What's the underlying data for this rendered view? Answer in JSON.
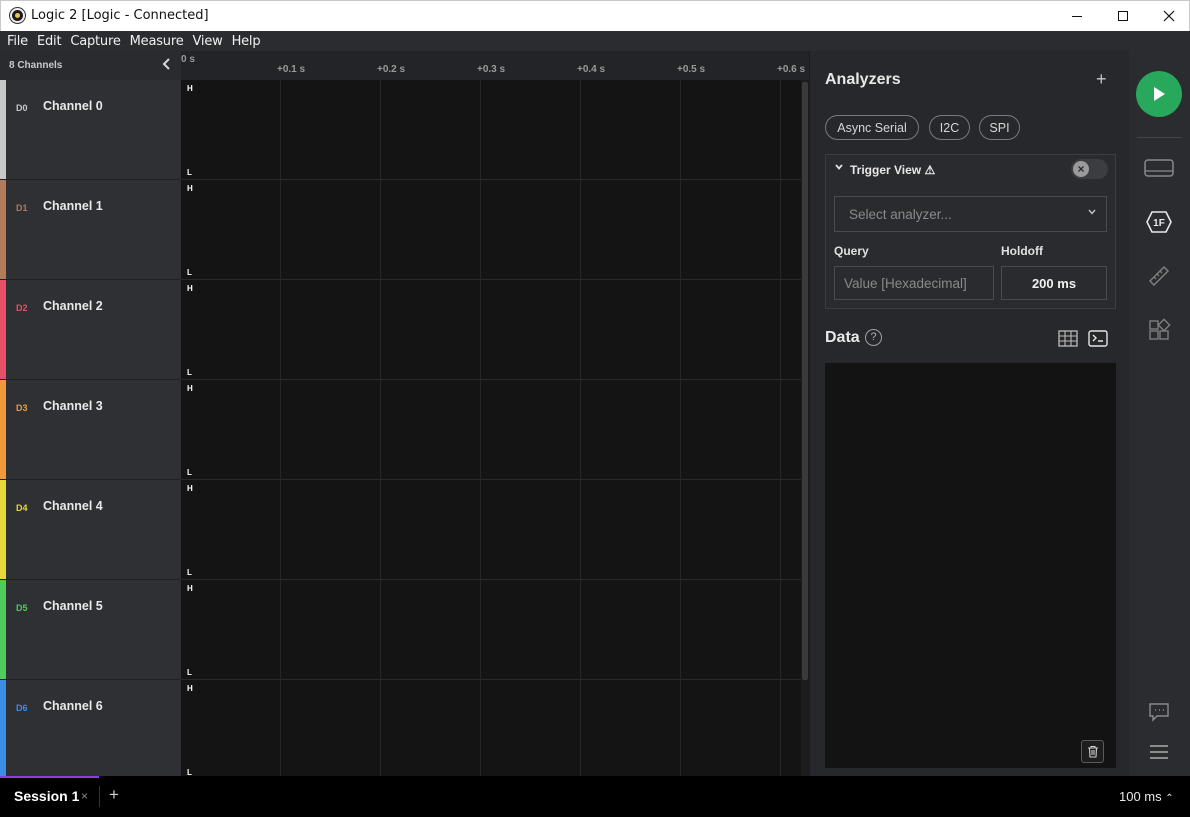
{
  "window": {
    "title": "Logic 2 [Logic - Connected]"
  },
  "menu": [
    "File",
    "Edit",
    "Capture",
    "Measure",
    "View",
    "Help"
  ],
  "channels_panel": {
    "count_label": "8 Channels",
    "channels": [
      {
        "tag": "D0",
        "name": "Channel 0",
        "color": "#c8c8c8"
      },
      {
        "tag": "D1",
        "name": "Channel 1",
        "color": "#b27b5a"
      },
      {
        "tag": "D2",
        "name": "Channel 2",
        "color": "#e8506a"
      },
      {
        "tag": "D3",
        "name": "Channel 3",
        "color": "#ee9a3a"
      },
      {
        "tag": "D4",
        "name": "Channel 4",
        "color": "#e8d83a"
      },
      {
        "tag": "D5",
        "name": "Channel 5",
        "color": "#4fcc5a"
      },
      {
        "tag": "D6",
        "name": "Channel 6",
        "color": "#3a8ee8"
      }
    ]
  },
  "timeline": {
    "zero_label": "0 s",
    "ticks": [
      "+0.1 s",
      "+0.2 s",
      "+0.3 s",
      "+0.4 s",
      "+0.5 s",
      "+0.6 s"
    ],
    "high_label": "H",
    "low_label": "L"
  },
  "analyzers": {
    "heading": "Analyzers",
    "add": "+",
    "quick_add": [
      "Async Serial",
      "I2C",
      "SPI"
    ],
    "trigger_view": {
      "label": "Trigger View",
      "warning": "⚠",
      "enabled": false,
      "select_placeholder": "Select analyzer...",
      "query_label": "Query",
      "query_placeholder": "Value [Hexadecimal]",
      "holdoff_label": "Holdoff",
      "holdoff_value": "200 ms"
    }
  },
  "data": {
    "heading": "Data",
    "help": "?"
  },
  "sidebar_icons": [
    "play-icon",
    "device-icon",
    "trigger-1f-icon",
    "measure-ruler-icon",
    "extensions-icon",
    "feedback-icon",
    "menu-icon"
  ],
  "bottom": {
    "session_tab": "Session 1",
    "close": "×",
    "add_tab": "+",
    "timescale": "100 ms",
    "timescale_caret": "⌃"
  },
  "colors": {
    "accent_play": "#27a85a",
    "active_tab": "#8a3ee0"
  }
}
